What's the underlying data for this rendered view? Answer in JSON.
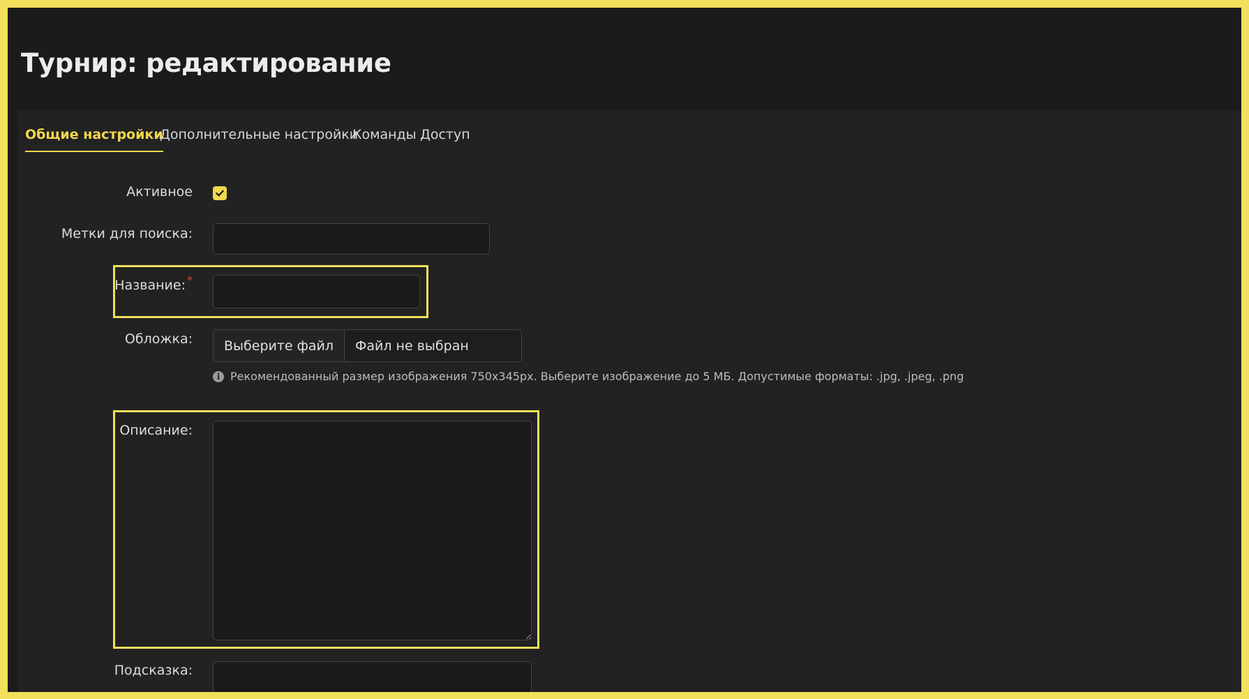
{
  "page": {
    "title": "Турнир: редактирование"
  },
  "tabs": [
    {
      "label": "Общие настройки",
      "active": true
    },
    {
      "label": "Дополнительные настройки",
      "active": false
    },
    {
      "label": "Команды",
      "active": false
    },
    {
      "label": "Доступ",
      "active": false
    }
  ],
  "form": {
    "active": {
      "label": "Активное",
      "checked": true
    },
    "tags": {
      "label": "Метки для поиска:",
      "value": ""
    },
    "name": {
      "label": "Название:",
      "required_mark": "*",
      "value": ""
    },
    "cover": {
      "label": "Обложка:",
      "button_label": "Выберите файл",
      "status": "Файл не выбран",
      "hint": "Рекомендованный размер изображения 750x345px. Выберите изображение до 5 МБ. Допустимые форматы: .jpg, .jpeg, .png"
    },
    "description": {
      "label": "Описание:",
      "value": ""
    },
    "tooltip": {
      "label": "Подсказка:",
      "value": ""
    }
  },
  "colors": {
    "accent": "#f2d84d",
    "highlight_border": "#f2df5c",
    "required": "#e0453a",
    "background": "#1b1b1b",
    "panel": "#222222"
  },
  "icons": {
    "check": "check-icon",
    "info": "info-icon",
    "resize": "resize-handle-icon"
  }
}
